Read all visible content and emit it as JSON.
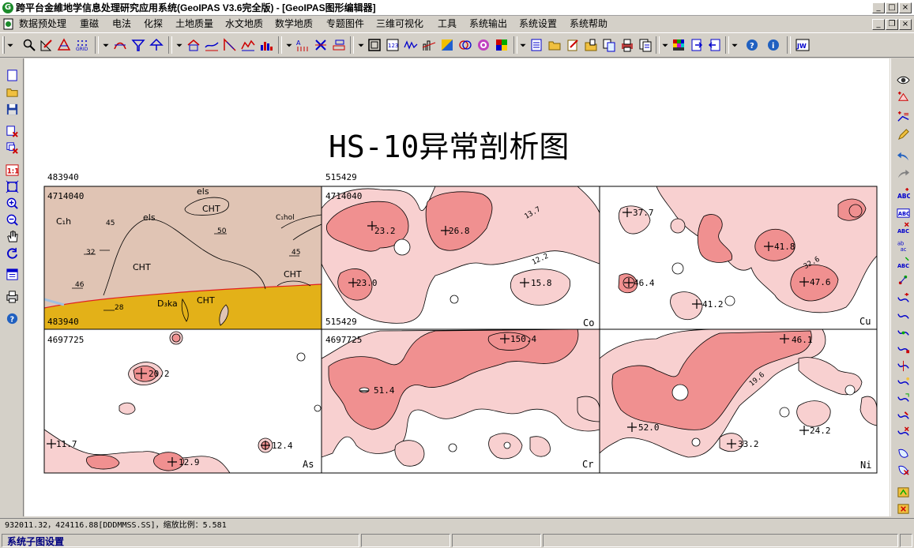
{
  "window": {
    "title": "跨平台金維地学信息处理研究应用系统(GeoIPAS V3.6完全版) - [GeoIPAS图形编辑器]"
  },
  "menu": [
    "数据预处理",
    "重磁",
    "电法",
    "化探",
    "土地质量",
    "水文地质",
    "数学地质",
    "专题图件",
    "三维可视化",
    "工具",
    "系统输出",
    "系统设置",
    "系统帮助"
  ],
  "map": {
    "title": "HS-10异常剖析图",
    "top_labels": {
      "left_x": "483940",
      "mid_x": "515429"
    },
    "bottom_labels": {
      "left_x": "483940",
      "mid_x": "515429"
    },
    "y_labels": {
      "upper": "4714040",
      "lower": "4697725"
    },
    "panels": [
      {
        "element": "",
        "kind": "geology"
      },
      {
        "element": "Co"
      },
      {
        "element": "Cu"
      },
      {
        "element": "As"
      },
      {
        "element": "Cr"
      },
      {
        "element": "Ni"
      }
    ],
    "geology_labels": [
      "els",
      "CHT",
      "els",
      "C₁h",
      "45",
      "50",
      "32",
      "CHT",
      "45",
      "CHT",
      "46",
      "28",
      "D₃ka",
      "CHT",
      "C₁hol"
    ],
    "co_values": [
      "23.2",
      "26.8",
      "23.0",
      "15.8",
      "13.7",
      "12.2"
    ],
    "cu_values": [
      "37.7",
      "41.8",
      "46.4",
      "41.2",
      "47.6",
      "32.6"
    ],
    "as_values": [
      "20.2",
      "11.7",
      "12.9",
      "12.4"
    ],
    "cr_values": [
      "150.4",
      "51.4"
    ],
    "ni_values": [
      "46.1",
      "52.0",
      "33.2",
      "24.2",
      "19.6"
    ],
    "colors": {
      "geo_bg": "#e0c4b4",
      "geo_yellow": "#e3b118",
      "anomaly_dark": "#f09090",
      "anomaly_light": "#f8d0d0",
      "redline": "#e02020"
    }
  },
  "status": {
    "coords": "932011.32，424116.88[DDDMMSS.SS]，缩放比例：5.581",
    "mode": "系统子图设置"
  }
}
